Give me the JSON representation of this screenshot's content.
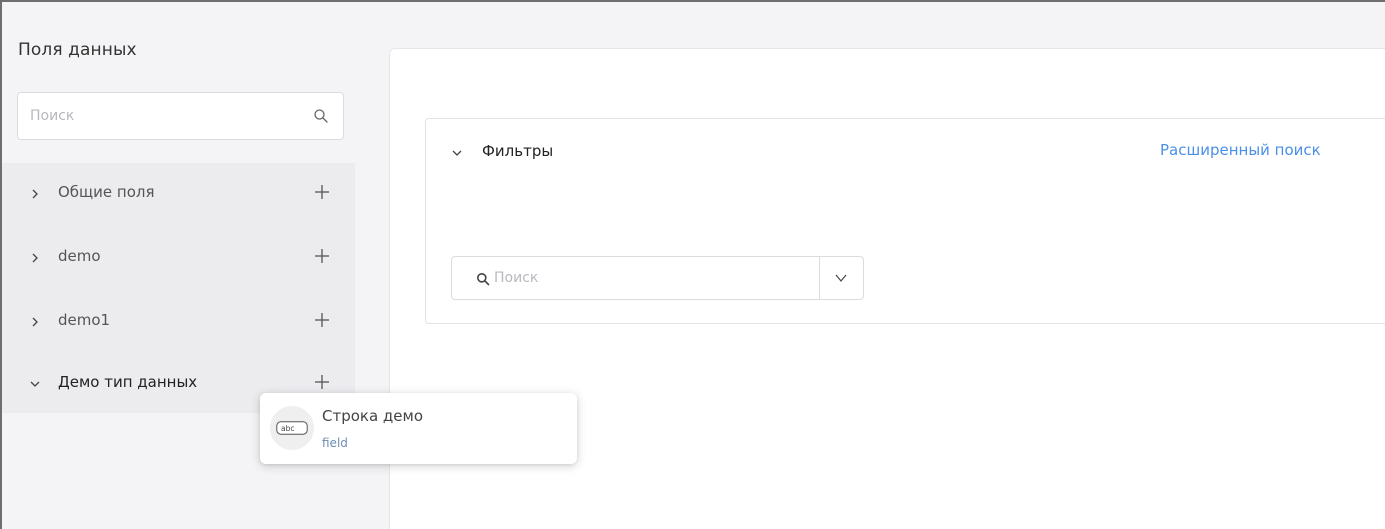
{
  "sidebar": {
    "title": "Поля данных",
    "search_placeholder": "Поиск",
    "items": [
      {
        "label": "Общие поля",
        "expanded": false
      },
      {
        "label": "demo",
        "expanded": false
      },
      {
        "label": "demo1",
        "expanded": false
      },
      {
        "label": "Демо тип данных",
        "expanded": true
      }
    ]
  },
  "filters": {
    "title": "Фильтры",
    "advanced_search_label": "Расширенный поиск",
    "search_placeholder": "Поиск"
  },
  "popup": {
    "icon_text": "abc",
    "name": "Строка демо",
    "type": "field"
  },
  "colors": {
    "link": "#4a8fe8",
    "field_type": "#6d8db5"
  }
}
